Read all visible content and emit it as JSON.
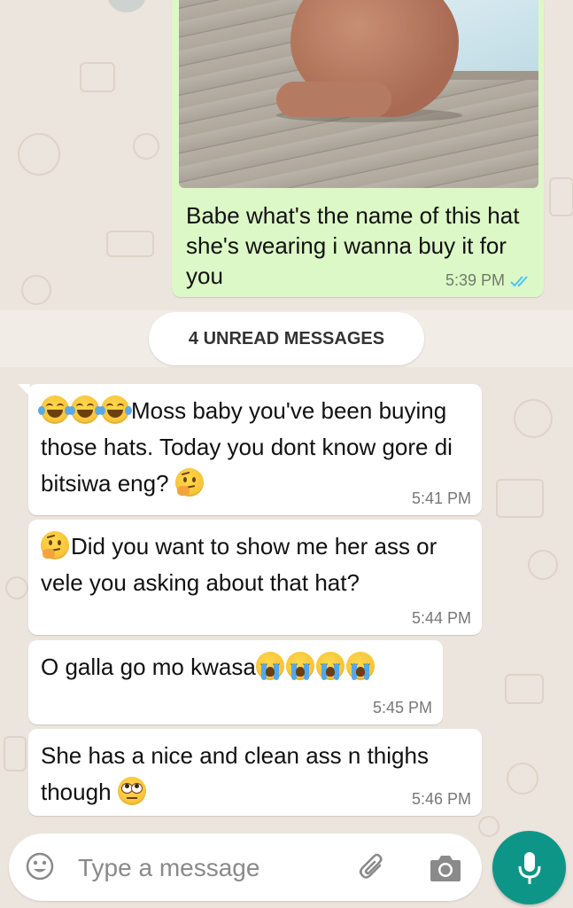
{
  "colors": {
    "background": "#ece5dd",
    "outgoing_bubble": "#dcf8c6",
    "incoming_bubble": "#ffffff",
    "read_ticks": "#4fc3f7",
    "accent": "#0d9688"
  },
  "outgoing": {
    "image_icon": "shared-photo",
    "text": "Babe what's the name of this hat she's wearing i wanna buy it for you",
    "time": "5:39 PM",
    "status_icon": "double-check-read-icon"
  },
  "unread_label": "4 UNREAD MESSAGES",
  "incoming": [
    {
      "lead_emoji": [
        "face-with-tears-of-joy",
        "face-with-tears-of-joy",
        "face-with-tears-of-joy"
      ],
      "text": "Moss baby you've been buying those hats. Today you dont know gore di bitsiwa eng?",
      "trail_emoji": [
        "thinking-face"
      ],
      "time": "5:41 PM"
    },
    {
      "lead_emoji": [
        "thinking-face"
      ],
      "text": "Did you want to show me her ass or vele you asking about that hat?",
      "time": "5:44 PM"
    },
    {
      "text": "O galla go mo kwasa",
      "trail_emoji": [
        "loudly-crying-face",
        "loudly-crying-face",
        "loudly-crying-face",
        "loudly-crying-face"
      ],
      "time": "5:45 PM"
    },
    {
      "text": "She has a nice and clean ass n thighs though",
      "trail_emoji": [
        "face-with-rolling-eyes"
      ],
      "time": "5:46 PM"
    }
  ],
  "input": {
    "placeholder": "Type a message",
    "value": "",
    "emoji_icon": "smiley-icon",
    "attach_icon": "paperclip-icon",
    "camera_icon": "camera-icon",
    "send_icon": "microphone-icon"
  }
}
